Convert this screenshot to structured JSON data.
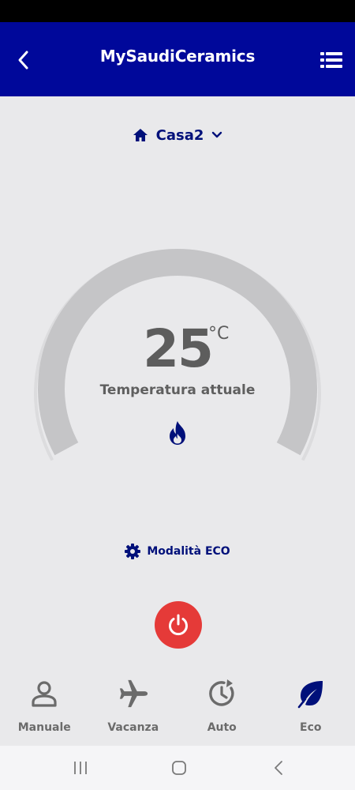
{
  "header": {
    "title": "MySaudiCeramics",
    "back_icon": "chevron-left-icon",
    "menu_icon": "list-menu-icon",
    "background": "#00089a"
  },
  "home": {
    "name": "Casa2",
    "icon": "home-icon",
    "dropdown_icon": "chevron-down-icon"
  },
  "thermostat": {
    "temperature": "25",
    "unit": "°C",
    "label": "Temperatura attuale",
    "status_icon": "flame-icon"
  },
  "mode": {
    "label": "Modalità ECO",
    "icon": "gear-icon"
  },
  "power": {
    "icon": "power-icon",
    "color": "#e53a38"
  },
  "bottom_nav": {
    "items": [
      {
        "label": "Manuale",
        "icon": "person-icon",
        "active": false
      },
      {
        "label": "Vacanza",
        "icon": "airplane-icon",
        "active": false
      },
      {
        "label": "Auto",
        "icon": "clock-refresh-icon",
        "active": false
      },
      {
        "label": "Eco",
        "icon": "leaf-icon",
        "active": true
      }
    ]
  },
  "colors": {
    "accent": "#00107a",
    "background": "#e9e9eb",
    "inactive": "#6b6b6b"
  }
}
